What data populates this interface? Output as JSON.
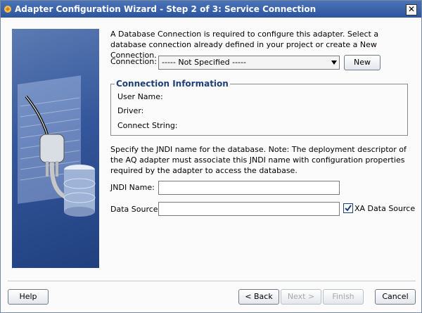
{
  "window": {
    "title": "Adapter Configuration Wizard - Step 2 of 3: Service Connection",
    "close_glyph": "✕"
  },
  "intro_text": "A Database Connection is required to configure this adapter. Select a database connection already defined in your project or create a New Connection.",
  "connection": {
    "label": "Connection:",
    "selected": "----- Not Specified -----",
    "new_button": "New"
  },
  "connection_info": {
    "title": "Connection Information",
    "user_name_label": "User Name:",
    "driver_label": "Driver:",
    "connect_string_label": "Connect String:"
  },
  "jndi_text": "Specify the JNDI name for the database.  Note: The deployment descriptor of the AQ adapter must associate this JNDI name with configuration properties required by the adapter to access the database.",
  "jndi": {
    "label": "JNDI Name:",
    "value": ""
  },
  "data_source": {
    "label": "Data Source:",
    "value": ""
  },
  "xa": {
    "label": "XA Data Source",
    "checked": true
  },
  "buttons": {
    "help": "Help",
    "back": "< Back",
    "next": "Next >",
    "finish": "Finish",
    "cancel": "Cancel"
  },
  "colors": {
    "title_bar": "#2c559e",
    "accent": "#1f3f7a",
    "art": "#34569a"
  }
}
